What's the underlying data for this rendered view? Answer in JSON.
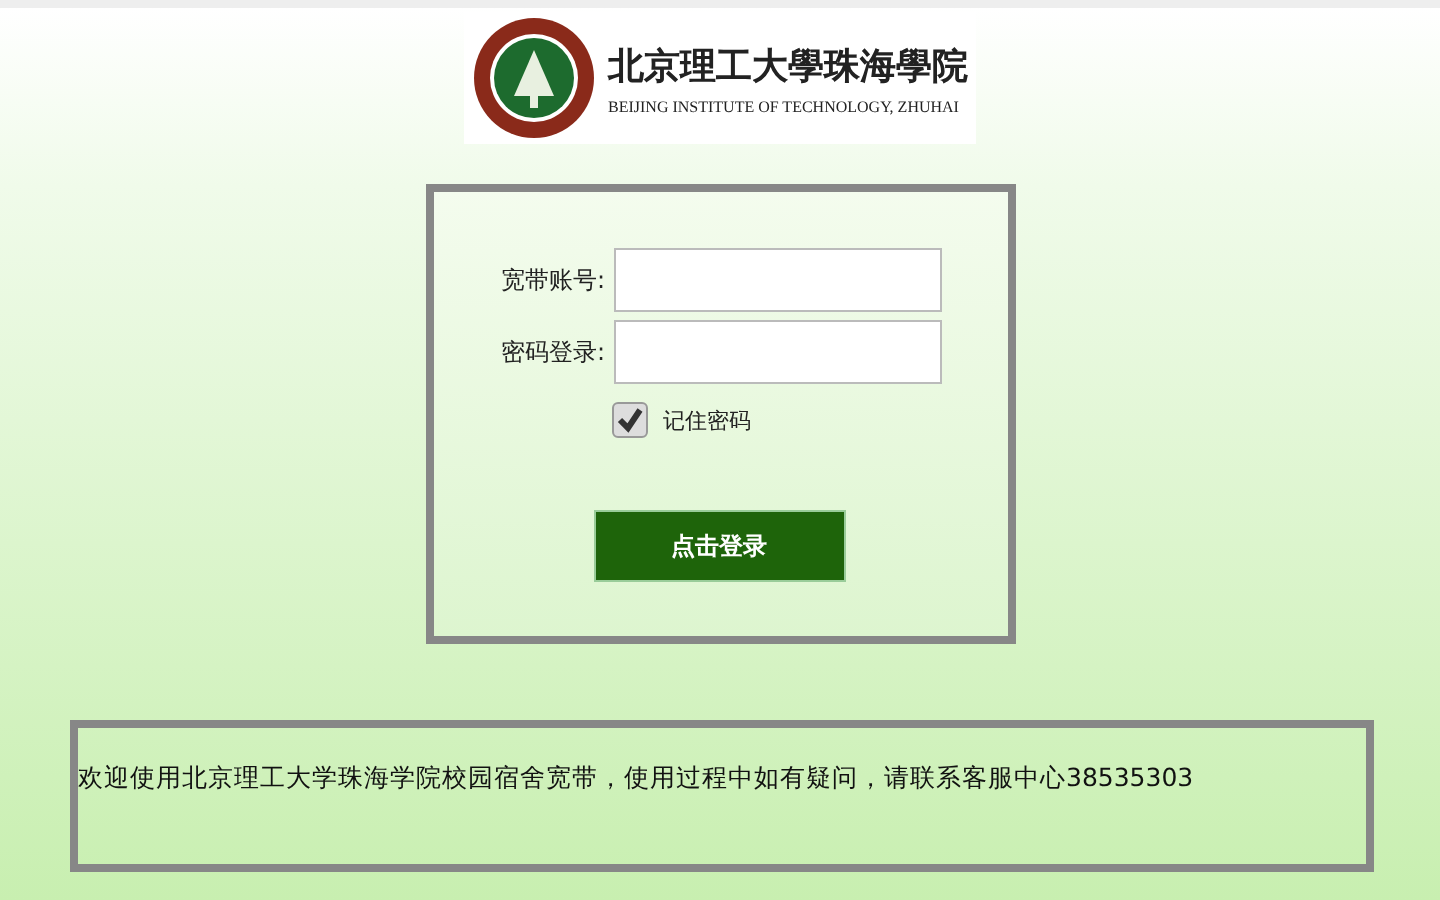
{
  "logo": {
    "name_cn": "北京理工大學珠海學院",
    "name_en": "BEIJING INSTITUTE OF TECHNOLOGY, ZHUHAI"
  },
  "login": {
    "fields": [
      {
        "label": "宽带账号:"
      },
      {
        "label": "密码登录:"
      }
    ],
    "remember": {
      "label": "记住密码",
      "checked": true
    },
    "button": "点击登录"
  },
  "notice": "欢迎使用北京理工大学珠海学院校园宿舍宽带，使用过程中如有疑问，请联系客服中心38535303"
}
